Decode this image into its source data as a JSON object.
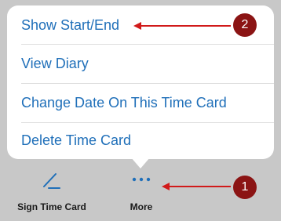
{
  "menu": {
    "items": [
      {
        "label": "Show Start/End"
      },
      {
        "label": "View Diary"
      },
      {
        "label": "Change Date On This Time Card"
      },
      {
        "label": "Delete Time Card"
      }
    ]
  },
  "toolbar": {
    "sign_label": "Sign Time Card",
    "sign_icon": "pen-icon",
    "more_label": "More",
    "more_icon": "ellipsis-icon"
  },
  "annotations": {
    "callout_1": "1",
    "callout_2": "2"
  },
  "colors": {
    "link": "#1f6fb9",
    "background": "#c8c8c8",
    "callout": "#8b1414",
    "arrow": "#d11a1a"
  }
}
